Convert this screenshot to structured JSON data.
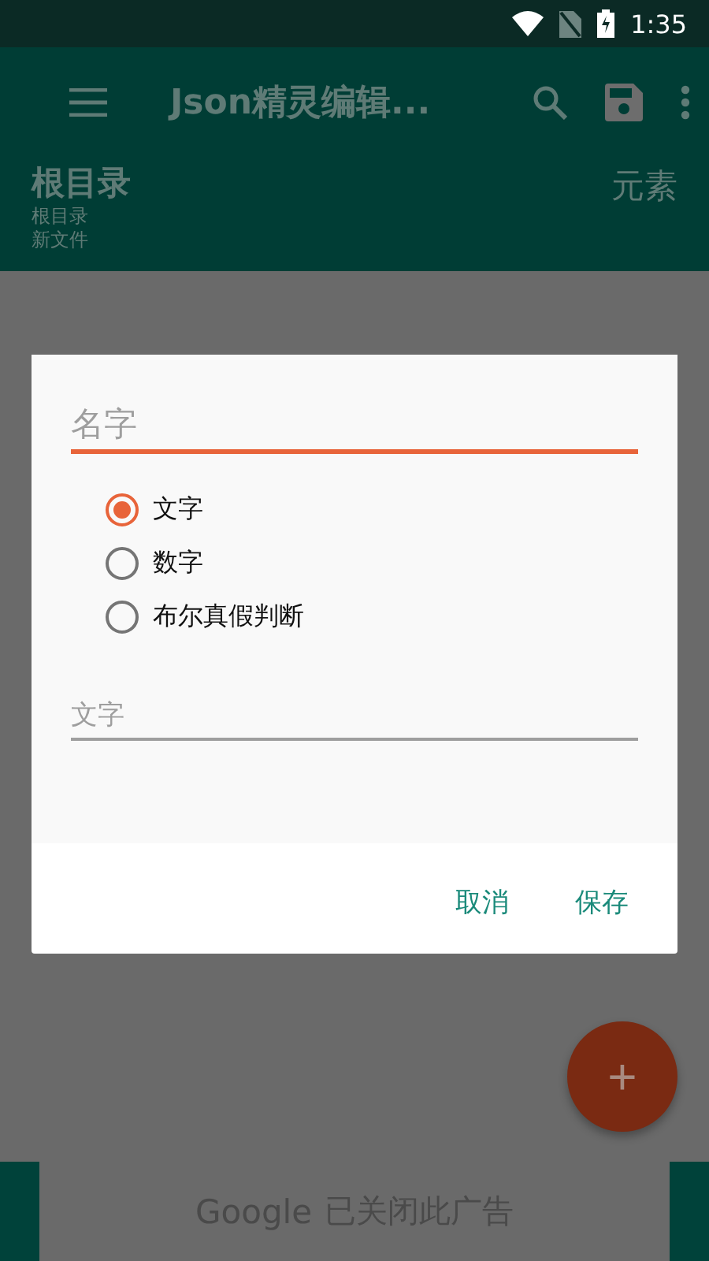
{
  "status_bar": {
    "time": "1:35"
  },
  "toolbar": {
    "title": "Json精灵编辑..."
  },
  "header": {
    "title": "根目录",
    "path": "根目录",
    "file": "新文件",
    "type": "元素"
  },
  "dialog": {
    "name_field": {
      "placeholder": "名字",
      "focused": true
    },
    "options": [
      {
        "label": "文字",
        "selected": true
      },
      {
        "label": "数字",
        "selected": false
      },
      {
        "label": "布尔真假判断",
        "selected": false
      }
    ],
    "value_field": {
      "placeholder": "文字"
    },
    "buttons": [
      "取消",
      "保存"
    ]
  },
  "fab": {
    "label": "+"
  },
  "ad": {
    "brand": "Google",
    "text": "已关闭此广告"
  }
}
